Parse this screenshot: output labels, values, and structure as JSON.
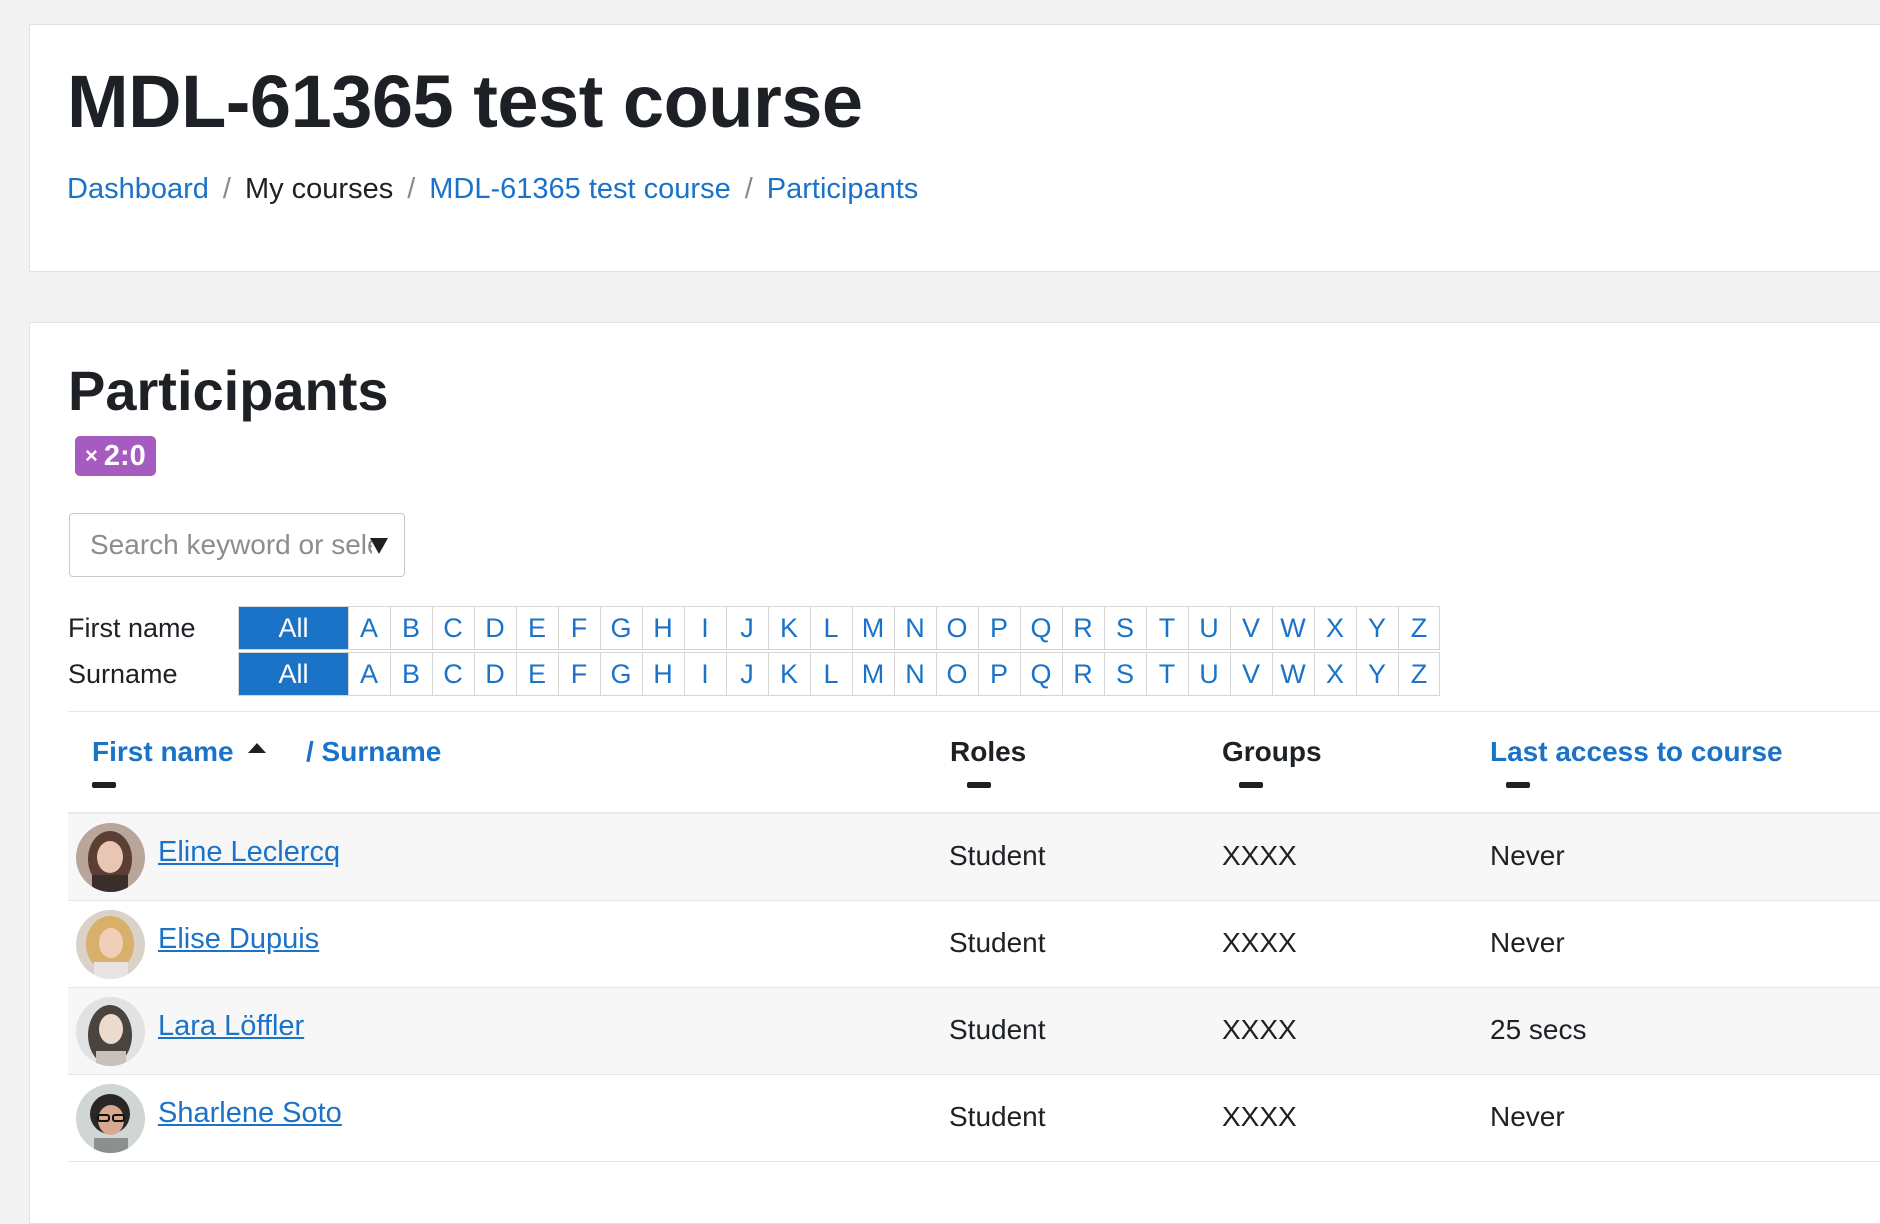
{
  "header": {
    "course_title": "MDL-61365 test course",
    "breadcrumb": {
      "dashboard": "Dashboard",
      "my_courses": "My courses",
      "course": "MDL-61365 test course",
      "participants": "Participants",
      "separator": "/"
    }
  },
  "participants": {
    "title": "Participants",
    "badge": {
      "icon": "×",
      "text": "2:0"
    },
    "search": {
      "placeholder": "Search keyword or select filter"
    },
    "initials": {
      "first_name_label": "First name",
      "surname_label": "Surname",
      "all_label": "All",
      "letters": [
        "A",
        "B",
        "C",
        "D",
        "E",
        "F",
        "G",
        "H",
        "I",
        "J",
        "K",
        "L",
        "M",
        "N",
        "O",
        "P",
        "Q",
        "R",
        "S",
        "T",
        "U",
        "V",
        "W",
        "X",
        "Y",
        "Z"
      ]
    },
    "table": {
      "headers": {
        "first_name": "First name",
        "surname": "/ Surname",
        "roles": "Roles",
        "groups": "Groups",
        "last_access": "Last access to course"
      },
      "rows": [
        {
          "name": "Eline Leclercq",
          "role": "Student",
          "groups": "XXXX",
          "last_access": "Never"
        },
        {
          "name": "Elise Dupuis",
          "role": "Student",
          "groups": "XXXX",
          "last_access": "Never"
        },
        {
          "name": "Lara Löffler",
          "role": "Student",
          "groups": "XXXX",
          "last_access": "25 secs"
        },
        {
          "name": "Sharlene Soto",
          "role": "Student",
          "groups": "XXXX",
          "last_access": "Never"
        }
      ]
    }
  },
  "colors": {
    "link": "#1b73c8",
    "badge": "#a55bc0",
    "text": "#1d2125",
    "background": "#f2f2f2"
  }
}
